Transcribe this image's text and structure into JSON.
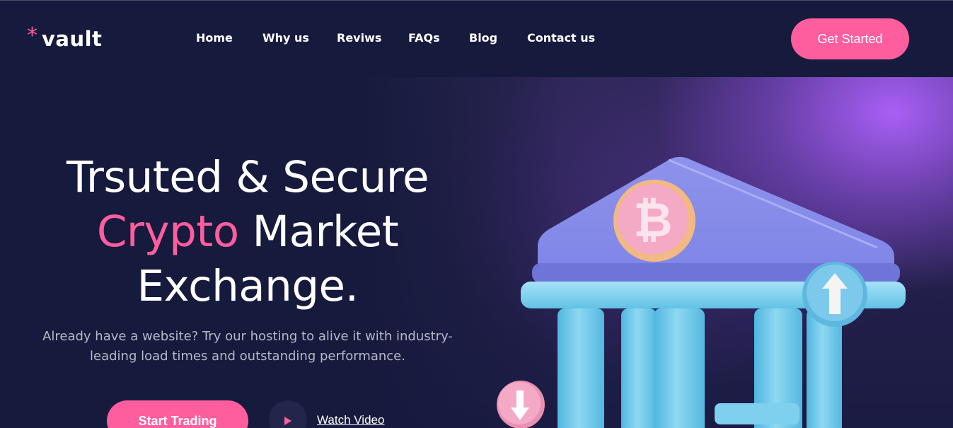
{
  "brand": {
    "star": "*",
    "name": "vault"
  },
  "nav": {
    "items": [
      "Home",
      "Why us",
      "Reviws",
      "FAQs",
      "Blog",
      "Contact us"
    ]
  },
  "header": {
    "cta_label": "Get Started"
  },
  "hero": {
    "line1": "Trsuted & Secure",
    "line2_accent": "Crypto",
    "line2_rest": "Market",
    "line3": "Exchange.",
    "description": "Already have a website? Try our hosting to alive it with industry-leading load times and outstanding performance.",
    "primary_cta": "Start Trading",
    "video_link": "Watch Video"
  },
  "illustration": {
    "coin_symbol": "₿"
  },
  "colors": {
    "accent": "#ff5e9e",
    "background": "#161a3c",
    "purple_glow": "#b062ff"
  },
  "icons": [
    "asterisk-icon",
    "play-icon",
    "bitcoin-icon",
    "arrow-up-icon",
    "arrow-down-icon"
  ]
}
